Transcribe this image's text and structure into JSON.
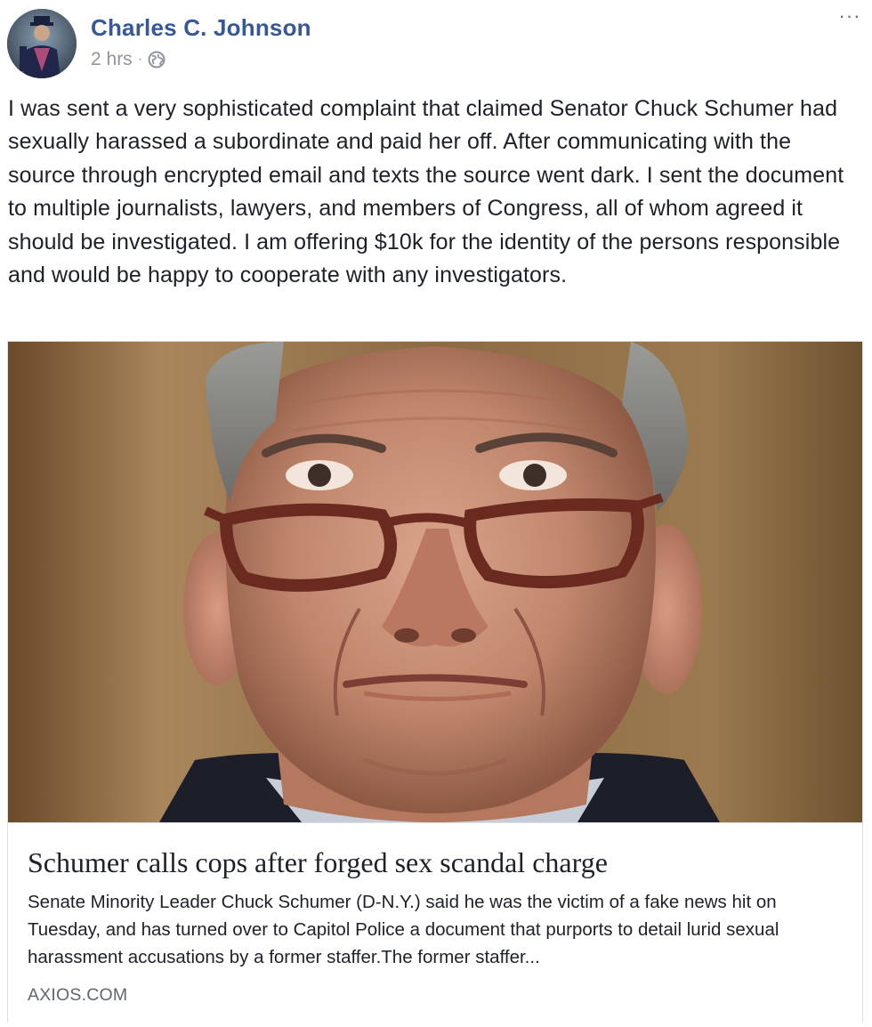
{
  "post": {
    "author_name": "Charles C. Johnson",
    "timestamp": "2 hrs",
    "separator": "·",
    "privacy_icon": "globe-icon",
    "more_icon": "more-options-icon",
    "more_label": "···",
    "text": "I was sent a very sophisticated complaint that claimed Senator Chuck Schumer had sexually harassed a subordinate and paid her off. After communicating with the source through encrypted email and texts the source went dark. I sent the document to multiple journalists, lawyers, and members of Congress, all of whom agreed it should be investigated. I am offering $10k for the identity of the persons responsible and would be happy to cooperate with any investigators."
  },
  "link_card": {
    "title": "Schumer calls cops after forged sex scandal charge",
    "description": "Senate Minority Leader Chuck Schumer (D-N.Y.) said he was the victim of a fake news hit on Tuesday, and has turned over to Capitol Police a document that purports to detail lurid sexual harassment accusations by a former staffer.The former staffer...",
    "domain": "AXIOS.COM"
  },
  "colors": {
    "author_link": "#365899",
    "meta_text": "#90949c",
    "body_text": "#1d2129",
    "card_border": "#dddfe2",
    "domain_text": "#606770"
  }
}
